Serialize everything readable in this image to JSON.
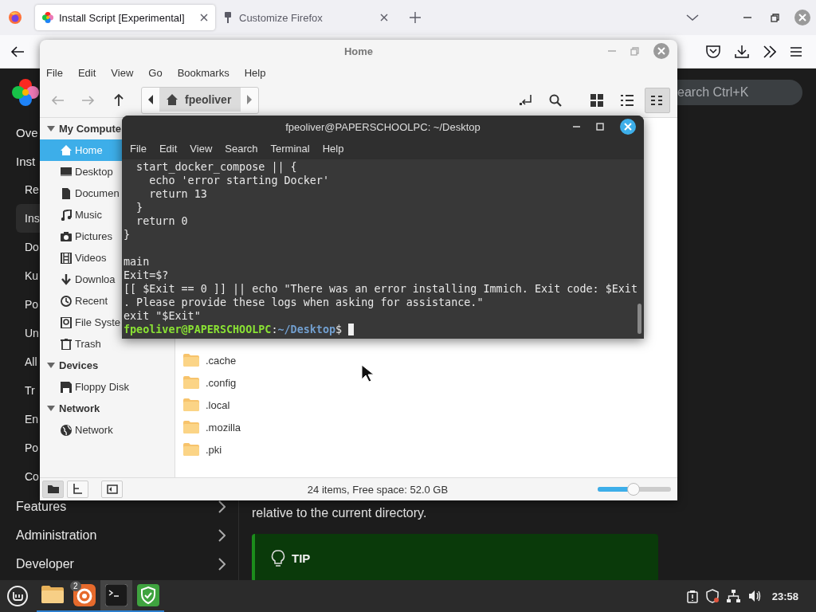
{
  "browser": {
    "tabs": [
      {
        "title": "Install Script [Experimental]",
        "selected": true
      },
      {
        "title": "Customize Firefox",
        "selected": false
      }
    ]
  },
  "page": {
    "search_placeholder": "earch Ctrl+K",
    "nav": [
      {
        "label": "Ove",
        "selected": false
      },
      {
        "label": "Inst",
        "selected": false,
        "children": [
          {
            "label": "Re",
            "selected": false
          },
          {
            "label": "Ins",
            "selected": true
          },
          {
            "label": "Do",
            "selected": false
          },
          {
            "label": "Ku",
            "selected": false
          },
          {
            "label": "Po",
            "selected": false
          },
          {
            "label": "Un",
            "selected": false
          },
          {
            "label": "All",
            "selected": false
          },
          {
            "label": "Tr",
            "selected": false
          },
          {
            "label": "En",
            "selected": false
          },
          {
            "label": "Po",
            "selected": false
          },
          {
            "label": "Co",
            "selected": false
          }
        ]
      },
      {
        "label": "Features",
        "selected": false,
        "expandable": true
      },
      {
        "label": "Administration",
        "selected": false,
        "expandable": true
      },
      {
        "label": "Developer",
        "selected": false,
        "expandable": true
      }
    ],
    "paragraph": "relative to the current directory.",
    "tip": {
      "label": "TIP"
    }
  },
  "file_manager": {
    "title": "Home",
    "menu": [
      "File",
      "Edit",
      "View",
      "Go",
      "Bookmarks",
      "Help"
    ],
    "location": "fpeoliver",
    "views": [
      {
        "kind": "icons",
        "selected": false
      },
      {
        "kind": "list",
        "selected": false
      },
      {
        "kind": "compact",
        "selected": true
      }
    ],
    "sidebar": [
      {
        "title": "My Compute",
        "expanded": true,
        "items": [
          {
            "label": "Home",
            "kind": "home",
            "selected": true
          },
          {
            "label": "Desktop",
            "kind": "desktop",
            "selected": false
          },
          {
            "label": "Documen",
            "kind": "documents",
            "selected": false
          },
          {
            "label": "Music",
            "kind": "music",
            "selected": false
          },
          {
            "label": "Pictures",
            "kind": "pictures",
            "selected": false
          },
          {
            "label": "Videos",
            "kind": "videos",
            "selected": false
          },
          {
            "label": "Downloa",
            "kind": "downloads",
            "selected": false
          },
          {
            "label": "Recent",
            "kind": "recent",
            "selected": false
          },
          {
            "label": "File Syste",
            "kind": "filesystem",
            "selected": false
          },
          {
            "label": "Trash",
            "kind": "trash",
            "selected": false
          }
        ]
      },
      {
        "title": "Devices",
        "expanded": true,
        "items": [
          {
            "label": "Floppy Disk",
            "kind": "drive",
            "selected": false
          }
        ]
      },
      {
        "title": "Network",
        "expanded": true,
        "items": [
          {
            "label": "Network",
            "kind": "network",
            "selected": false
          }
        ]
      }
    ],
    "files": [
      {
        "name": ".cache"
      },
      {
        "name": ".config"
      },
      {
        "name": ".local"
      },
      {
        "name": ".mozilla"
      },
      {
        "name": ".pki"
      }
    ],
    "sidebar_modes": [
      {
        "kind": "places",
        "selected": true
      },
      {
        "kind": "tree",
        "selected": false
      }
    ],
    "status": "24 items, Free space: 52.0 GB",
    "zoom": {
      "level": 0.49
    }
  },
  "terminal": {
    "title": "fpeoliver@PAPERSCHOOLPC: ~/Desktop",
    "menu": [
      "File",
      "Edit",
      "View",
      "Search",
      "Terminal",
      "Help"
    ],
    "blocks": [
      [
        "  start_docker_compose || {",
        "    echo 'error starting Docker'",
        "    return 13",
        "  }",
        "  return 0",
        "}"
      ],
      [
        "main",
        "Exit=$?",
        "[[ $Exit == 0 ]] || echo \"There was an error installing Immich. Exit code: $Exit",
        ". Please provide these logs when asking for assistance.\"",
        "exit \"$Exit\""
      ]
    ],
    "prompt": {
      "user": "fpeoliver@PAPERSCHOOLPC",
      "separator": ":",
      "path": "~/Desktop",
      "symbol": "$"
    }
  },
  "taskbar": {
    "apps": [
      {
        "kind": "files",
        "running": true,
        "active": false
      },
      {
        "kind": "browser",
        "running": true,
        "active": false,
        "badge": "2"
      },
      {
        "kind": "terminal",
        "running": true,
        "active": true
      },
      {
        "kind": "shield",
        "running": true,
        "active": false
      }
    ],
    "clock": "23:58"
  }
}
